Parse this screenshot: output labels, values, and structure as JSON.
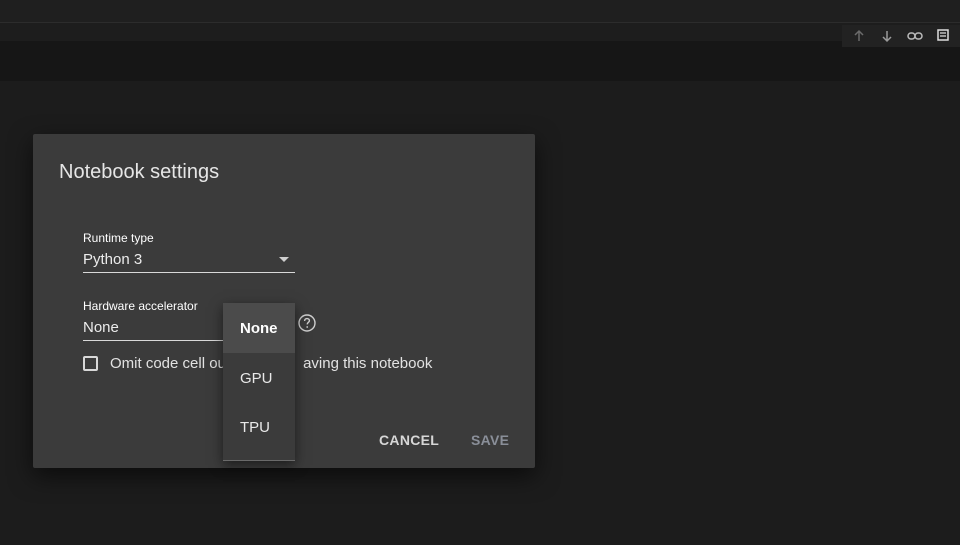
{
  "dialog": {
    "title": "Notebook settings",
    "runtime_type": {
      "label": "Runtime type",
      "value": "Python 3"
    },
    "hardware_accelerator": {
      "label": "Hardware accelerator",
      "value": "None",
      "options": [
        "None",
        "GPU",
        "TPU"
      ],
      "highlighted_option": "None"
    },
    "omit_output": {
      "label_before": "Omit code cell out",
      "label_after": "aving this notebook",
      "checked": false
    },
    "buttons": {
      "cancel": "CANCEL",
      "save": "SAVE"
    }
  },
  "cell_toolbar": {
    "icons": [
      "arrow-up-icon",
      "arrow-down-icon",
      "link-icon",
      "comment-icon"
    ]
  },
  "colors": {
    "dialog_bg": "#3b3b3b",
    "page_bg": "#1c1c1c",
    "save_disabled": "#8a8f99"
  }
}
